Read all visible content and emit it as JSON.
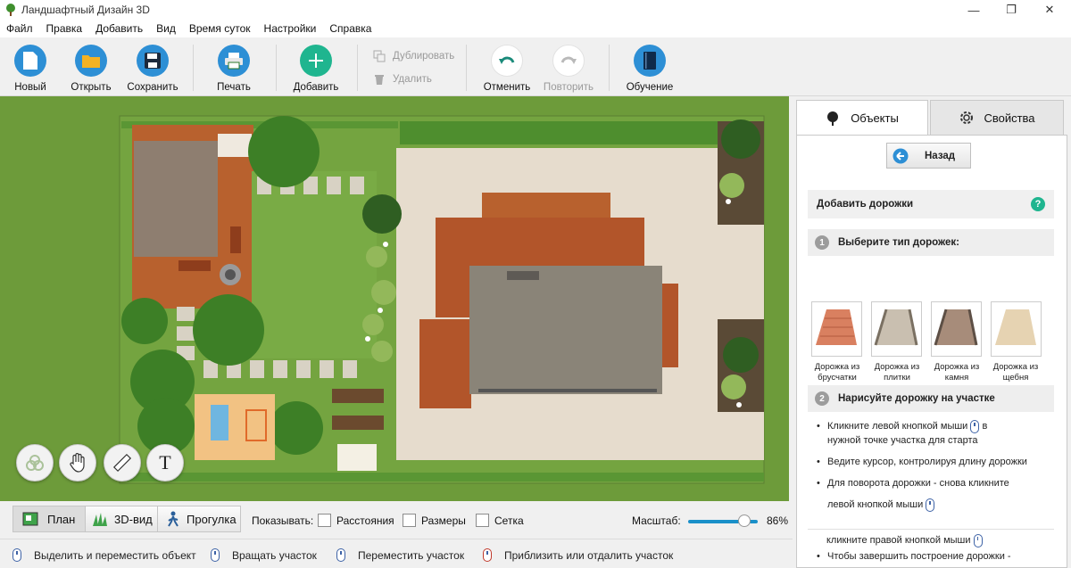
{
  "window": {
    "title": "Ландшафтный Дизайн 3D"
  },
  "menu": [
    "Файл",
    "Правка",
    "Добавить",
    "Вид",
    "Время суток",
    "Настройки",
    "Справка"
  ],
  "toolbar": {
    "new": "Новый",
    "open": "Открыть",
    "save": "Сохранить",
    "print": "Печать",
    "add": "Добавить",
    "duplicate": "Дублировать",
    "delete": "Удалить",
    "undo": "Отменить",
    "redo": "Повторить",
    "tutorial": "Обучение"
  },
  "canvas_tools": {
    "text_tool": "T"
  },
  "tabs": {
    "objects": "Объекты",
    "properties": "Свойства"
  },
  "panel": {
    "back": "Назад",
    "heading": "Добавить дорожки",
    "help": "?",
    "step1": {
      "num": "1",
      "title": "Выберите тип дорожек:"
    },
    "paths": [
      {
        "label1": "Дорожка из",
        "label2": "брусчатки"
      },
      {
        "label1": "Дорожка из",
        "label2": "плитки"
      },
      {
        "label1": "Дорожка из",
        "label2": "камня"
      },
      {
        "label1": "Дорожка из",
        "label2": "щебня"
      }
    ],
    "step2": {
      "num": "2",
      "title": "Нарисуйте дорожку на участке"
    },
    "bullets": {
      "b1a": "Кликните левой кнопкой мыши",
      "b1b": "в",
      "b1c": "нужной точке участка для старта",
      "b2": "Ведите курсор, контролируя длину дорожки",
      "b3a": "Для поворота дорожки - снова кликните",
      "b3b": "левой кнопкой мыши",
      "b4a": "Чтобы завершить построение дорожки -",
      "b4b": "кликните правой кнопкой мыши"
    },
    "bullet_char": "•"
  },
  "viewbar": {
    "plan": "План",
    "view3d": "3D-вид",
    "walk": "Прогулка",
    "show": "Показывать:",
    "distances": "Расстояния",
    "sizes": "Размеры",
    "grid": "Сетка",
    "zoom_label": "Масштаб:",
    "zoom_value": "86%"
  },
  "status": {
    "s1": "Выделить и переместить объект",
    "s2": "Вращать участок",
    "s3": "Переместить участок",
    "s4": "Приблизить или отдалить участок"
  },
  "colors": {
    "accent": "#1a90c9",
    "grass": "#6d9b3a",
    "wood": "#b8612e",
    "roof": "#8a8478"
  }
}
